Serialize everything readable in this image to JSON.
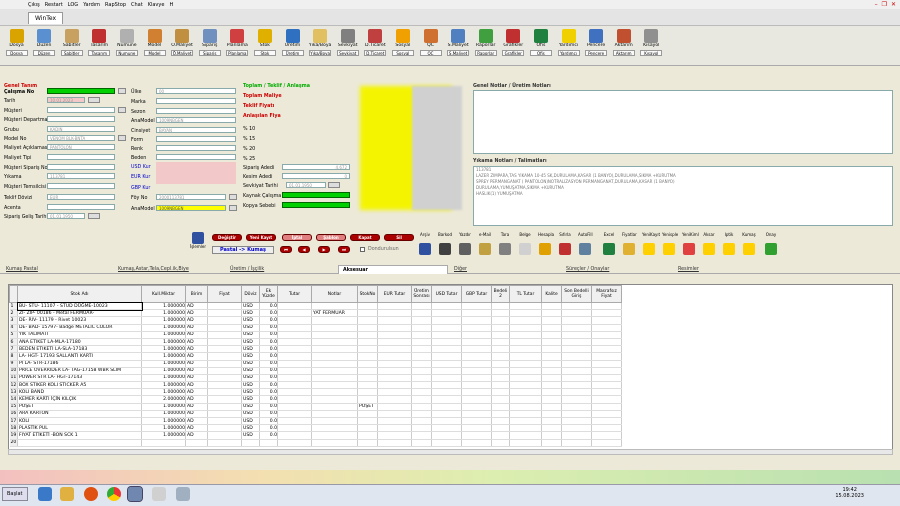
{
  "menu": [
    "Çıkış",
    "Restart",
    "LOG",
    "Yardım",
    "RapStop",
    "Chat",
    "Klavye",
    "H"
  ],
  "app_tab": "WinTex",
  "toolbar": [
    {
      "label": "Dosya",
      "dd": "Dosya",
      "color": "#d9a400"
    },
    {
      "label": "Düzen",
      "dd": "Düzen",
      "color": "#5a8fd0"
    },
    {
      "label": "Sabitler",
      "dd": "Sabitler",
      "color": "#c8a060"
    },
    {
      "label": "Tasarım",
      "dd": "Tasarım",
      "color": "#c03030"
    },
    {
      "label": "Numune",
      "dd": "Numune",
      "color": "#b0b0b0"
    },
    {
      "label": "Model",
      "dd": "Model",
      "color": "#d08030"
    },
    {
      "label": "Ö.Maliyet",
      "dd": "Ö.Maliyet",
      "color": "#c09040"
    },
    {
      "label": "Sipariş",
      "dd": "Sipariş",
      "color": "#7090c0"
    },
    {
      "label": "Planlama",
      "dd": "Planlama",
      "color": "#d04040"
    },
    {
      "label": "Stok",
      "dd": "Stok",
      "color": "#e0b000"
    },
    {
      "label": "Üretim",
      "dd": "Üretim",
      "color": "#3070c0"
    },
    {
      "label": "Yıka/Boya",
      "dd": "Yıka/Boya",
      "color": "#e0c060"
    },
    {
      "label": "Sevkiyat",
      "dd": "Sevkiyat",
      "color": "#808080"
    },
    {
      "label": "D.Ticaret",
      "dd": "D.Ticaret",
      "color": "#c04040"
    },
    {
      "label": "Sosyal",
      "dd": "Sosyal",
      "color": "#f0a000"
    },
    {
      "label": "QC",
      "dd": "QC",
      "color": "#d07030"
    },
    {
      "label": "S.Maliyet",
      "dd": "S.Maliyet",
      "color": "#5080c0"
    },
    {
      "label": "Raporlar",
      "dd": "Raporlar",
      "color": "#40a040"
    },
    {
      "label": "Grafikler",
      "dd": "Grafikler",
      "color": "#c03030"
    },
    {
      "label": "Ofis",
      "dd": "Ofis",
      "color": "#208040"
    },
    {
      "label": "Yardımcı",
      "dd": "Yardımcı",
      "color": "#f0d000"
    },
    {
      "label": "Pencere",
      "dd": "Pencere",
      "color": "#4070c0"
    },
    {
      "label": "Aktarım",
      "dd": "Aktarım",
      "color": "#c05030"
    },
    {
      "label": "Kısayol",
      "dd": "Kısayol",
      "color": "#909090"
    }
  ],
  "form": {
    "genel_tanim": "Genel Tanım",
    "calisma_no": "Çalışma No",
    "tarih": "Tarih",
    "tarih_val": "10.01.2023",
    "musteri": "Müşteri",
    "musteri_dep": "Müşteri Departmanı",
    "grubu": "Grubu",
    "grubu_val": "KADIN",
    "model_no": "Model No",
    "model_no_val": "VENOM BLK-BNTA",
    "model_aciklama": "Maliyet Açıklaması",
    "model_aciklama_val": "PANTOLON",
    "maliyet_tipi": "Maliyet Tipi",
    "musteri_siparis": "Müşteri Sipariş No",
    "yikama": "Yıkama",
    "yikama_val": "113781",
    "musteri_temsilci": "Müşteri Temsilcisi",
    "teklif_doviz": "Teklif Dövizi",
    "teklif_doviz_val": "EUR",
    "acenta": "Acenta",
    "siparis_gelis": "Sipariş Geliş Tarihi",
    "siparis_gelis_val": "01.01.1950",
    "ulke": "Ülke",
    "ulke_val": "00",
    "marka": "Marka",
    "sezon": "Sezon",
    "anamodel": "AnaModel",
    "anamodel_val": "1009NBGEN",
    "cinsiyet": "Cinsiyet",
    "cinsiyet_val": "BAYAN",
    "form": "Form",
    "renk": "Renk",
    "beden": "Beden",
    "usd_kur": "USD Kur",
    "eur_kur": "EUR Kur",
    "gbp_kur": "GBP Kur",
    "foy_no": "Föy No",
    "foy_no_val": "2000113781",
    "anamodel2": "AnaModel",
    "anamodel2_val": "1009NBGEN",
    "toplam": "Toplam / Teklif / Anlaşma",
    "toplam_maliyet": "Toplam Maliye",
    "teklif_fiyati": "Teklif Fiyatı",
    "anlasilan": "Anlaşılan Fiya",
    "pct10": "% 10",
    "pct15": "% 15",
    "pct20": "% 20",
    "pct25": "% 25",
    "siparis_adedi": "Sipariş Adedi",
    "siparis_adedi_val": "4.672",
    "kesim_adedi": "Kesim Adedi",
    "kesim_adedi_val": "0",
    "sevkiyat_tarihi": "Sevkiyat Tarihi",
    "sevkiyat_tarihi_val": "01.01.1950",
    "kaynak": "Kaynak Çalışma",
    "kopya": "Kopya Sebebi",
    "genel_notlar": "Genel Notlar / Üretim Notları",
    "yikama_notlar": "Yıkama Notları / Talimatları",
    "yikama_text1": "113781",
    "yikama_text2": "LAZER ZIMPARA,TAS YIKAMA 10-45 SK,DURULAMA,KASAR (1 BANYO),DURULAMA,SIKMA +KURUTMA",
    "yikama_text3": "SPREY PERMANGANAT ( PANTOLON)NOTRALIZASYON PERMANGANAT,DURULAMA,KASAR (1 BANYO)",
    "yikama_text4": "DURULAMA,YUMUŞATMA,SIKMA +KURUTMA",
    "yikama_text5": "HASLIK(1) YUMUŞATMA"
  },
  "actions": {
    "islemler": "İşlemler",
    "degistir": "Değiştir",
    "yeni_kayit": "Yeni Kayıt",
    "iptal": "İptal",
    "sablon": "Şablon",
    "kapat": "Kapat",
    "sil": "Sil",
    "pastal": "Pastal -> Kumaş",
    "dondur": "Dondurulsun"
  },
  "icon_buttons": [
    {
      "label": "Arşiv",
      "color": "#3050a0"
    },
    {
      "label": "Barkod",
      "color": "#404040"
    },
    {
      "label": "Yazdır",
      "color": "#606060"
    },
    {
      "label": "e-Mail",
      "color": "#c0a040"
    },
    {
      "label": "Tara",
      "color": "#808080"
    },
    {
      "label": "Belge",
      "color": "#d0d0d0"
    },
    {
      "label": "Hesapla",
      "color": "#e0a000"
    },
    {
      "label": "Sıfırla",
      "color": "#c03030"
    },
    {
      "label": "AutoFill",
      "color": "#6080a0"
    },
    {
      "label": "Excel",
      "color": "#208040"
    },
    {
      "label": "Fiyatlar",
      "color": "#e0b030"
    },
    {
      "label": "YeniKayıt",
      "color": "#ffd000"
    },
    {
      "label": "Yenisple",
      "color": "#ffd000"
    },
    {
      "label": "YeniKiml",
      "color": "#e04040"
    },
    {
      "label": "Aksar",
      "color": "#ffd000"
    },
    {
      "label": "Iptik",
      "color": "#ffd000"
    },
    {
      "label": "Kumaş",
      "color": "#ffd000"
    },
    {
      "label": "Onay",
      "color": "#30a030"
    }
  ],
  "tabs": [
    "Kumaş Pastal",
    "Kumaş,Astar,Tela,Cepl.ik,Biye",
    "Üretim / İşçilik",
    "Aksesuar",
    "Diğer",
    "Süreçler / Onaylar",
    "Resimler"
  ],
  "grid": {
    "headers": [
      "",
      "Stok Adı",
      "Kull.Miktar",
      "Birim",
      "Fiyat",
      "Döviz",
      "Ek Yüzde",
      "Tutar",
      "Notlar",
      "StokNo",
      "EUR Tutar",
      "Üretim Sonrası",
      "USD Tutar",
      "GBP Tutar",
      "Bedeli 2",
      "TL Tutar",
      "Kalite",
      "Son Bedelli Giriş",
      "Masrafsız Fiyat"
    ],
    "rows": [
      [
        "1",
        "BU- STU- 11107 - STUD DÜĞME-10023",
        "1.000000",
        "AD",
        "",
        "USD",
        "0.0",
        "",
        "",
        "",
        "",
        "",
        "",
        "",
        "",
        "",
        "",
        "",
        ""
      ],
      [
        "2",
        "ZI- ZIP- 00186 - Metal FERMUAR-",
        "1.000000",
        "AD",
        "",
        "USD",
        "0.0",
        "",
        "YAT FERMUAR",
        "",
        "",
        "",
        "",
        "",
        "",
        "",
        "",
        "",
        ""
      ],
      [
        "3",
        "DE- RIV- 11179 - Rivet 10023",
        "1.000000",
        "AD",
        "",
        "USD",
        "0.0",
        "",
        "",
        "",
        "",
        "",
        "",
        "",
        "",
        "",
        "",
        "",
        ""
      ],
      [
        "4",
        "DE- BAD- 15797- Badge METALIC COLOR",
        "1.000000",
        "AD",
        "",
        "USD",
        "0.0",
        "",
        "",
        "",
        "",
        "",
        "",
        "",
        "",
        "",
        "",
        "",
        ""
      ],
      [
        "5",
        "YIK TALIMATI",
        "1.000000",
        "AD",
        "",
        "USD",
        "0.0",
        "",
        "",
        "",
        "",
        "",
        "",
        "",
        "",
        "",
        "",
        "",
        ""
      ],
      [
        "6",
        "ANA ETIKET LA-MLA-17180",
        "1.000000",
        "AD",
        "",
        "USD",
        "0.0",
        "",
        "",
        "",
        "",
        "",
        "",
        "",
        "",
        "",
        "",
        "",
        ""
      ],
      [
        "7",
        "BEDEN ETIKETI LA-SLA-17183",
        "1.000000",
        "AD",
        "",
        "USD",
        "0.0",
        "",
        "",
        "",
        "",
        "",
        "",
        "",
        "",
        "",
        "",
        "",
        ""
      ],
      [
        "8",
        "LA- HGT- 17193 SALLANTI KARTI",
        "1.000000",
        "AD",
        "",
        "USD",
        "0.0",
        "",
        "",
        "",
        "",
        "",
        "",
        "",
        "",
        "",
        "",
        "",
        ""
      ],
      [
        "9",
        "PI LA- STR-17186",
        "1.000000",
        "AD",
        "",
        "USD",
        "0.0",
        "",
        "",
        "",
        "",
        "",
        "",
        "",
        "",
        "",
        "",
        "",
        ""
      ],
      [
        "10",
        "PRICE OVERRIDER LA- TAG-17158 WBR SLIM",
        "1.000000",
        "AD",
        "",
        "USD",
        "0.0",
        "",
        "",
        "",
        "",
        "",
        "",
        "",
        "",
        "",
        "",
        "",
        ""
      ],
      [
        "11",
        "POWER STR LA- HGT-17143",
        "1.000000",
        "AD",
        "",
        "USD",
        "0.0",
        "",
        "",
        "",
        "",
        "",
        "",
        "",
        "",
        "",
        "",
        "",
        ""
      ],
      [
        "12",
        "BOX STIKER KOLI STICKER A5",
        "1.000000",
        "AD",
        "",
        "USD",
        "0.0",
        "",
        "",
        "",
        "",
        "",
        "",
        "",
        "",
        "",
        "",
        "",
        ""
      ],
      [
        "13",
        "KOLI BAND",
        "1.000000",
        "AD",
        "",
        "USD",
        "0.0",
        "",
        "",
        "",
        "",
        "",
        "",
        "",
        "",
        "",
        "",
        "",
        ""
      ],
      [
        "14",
        "KEMER KARTI İÇİN KILÇIK",
        "2.000000",
        "AD",
        "",
        "USD",
        "0.0",
        "",
        "",
        "",
        "",
        "",
        "",
        "",
        "",
        "",
        "",
        "",
        ""
      ],
      [
        "15",
        "POŞET",
        "1.000000",
        "AD",
        "",
        "USD",
        "0.0",
        "",
        "",
        "POŞET",
        "",
        "",
        "",
        "",
        "",
        "",
        "",
        "",
        ""
      ],
      [
        "16",
        "ARA KARTON",
        "1.000000",
        "AD",
        "",
        "USD",
        "0.0",
        "",
        "",
        "",
        "",
        "",
        "",
        "",
        "",
        "",
        "",
        "",
        ""
      ],
      [
        "17",
        "KOLI",
        "1.000000",
        "AD",
        "",
        "USD",
        "0.0",
        "",
        "",
        "",
        "",
        "",
        "",
        "",
        "",
        "",
        "",
        "",
        ""
      ],
      [
        "18",
        "PLASTİK PUL",
        "1.000000",
        "AD",
        "",
        "USD",
        "0.0",
        "",
        "",
        "",
        "",
        "",
        "",
        "",
        "",
        "",
        "",
        "",
        ""
      ],
      [
        "19",
        "FIYAT ETİKETİ -BON SCK 1",
        "1.000000",
        "AD",
        "",
        "USD",
        "0.0",
        "",
        "",
        "",
        "",
        "",
        "",
        "",
        "",
        "",
        "",
        "",
        ""
      ],
      [
        "20",
        "",
        "",
        "",
        "",
        "",
        "",
        "",
        "",
        "",
        "",
        "",
        "",
        "",
        "",
        "",
        "",
        "",
        ""
      ]
    ]
  },
  "taskbar": {
    "start": "Başlat",
    "time": "19:42",
    "date": "15.08.2023"
  }
}
